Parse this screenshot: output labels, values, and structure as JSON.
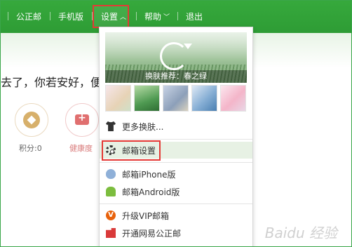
{
  "nav": {
    "items": [
      "公正邮",
      "手机版",
      "设置",
      "帮助",
      "退出"
    ]
  },
  "content": {
    "greeting": "去了，你若安好，便",
    "points_label": "积分:0",
    "health_label": "健康度"
  },
  "dropdown": {
    "banner_caption": "换肤推荐：春之绿",
    "menu_items": [
      "更多换肤...",
      "邮箱设置",
      "邮箱iPhone版",
      "邮箱Android版",
      "升级VIP邮箱",
      "开通网易公正邮"
    ]
  },
  "watermark": "Baidu 经验",
  "colors": {
    "header_green": "#36a93c",
    "highlight_red": "#e53935",
    "menu_hover": "#e7f1e4"
  }
}
